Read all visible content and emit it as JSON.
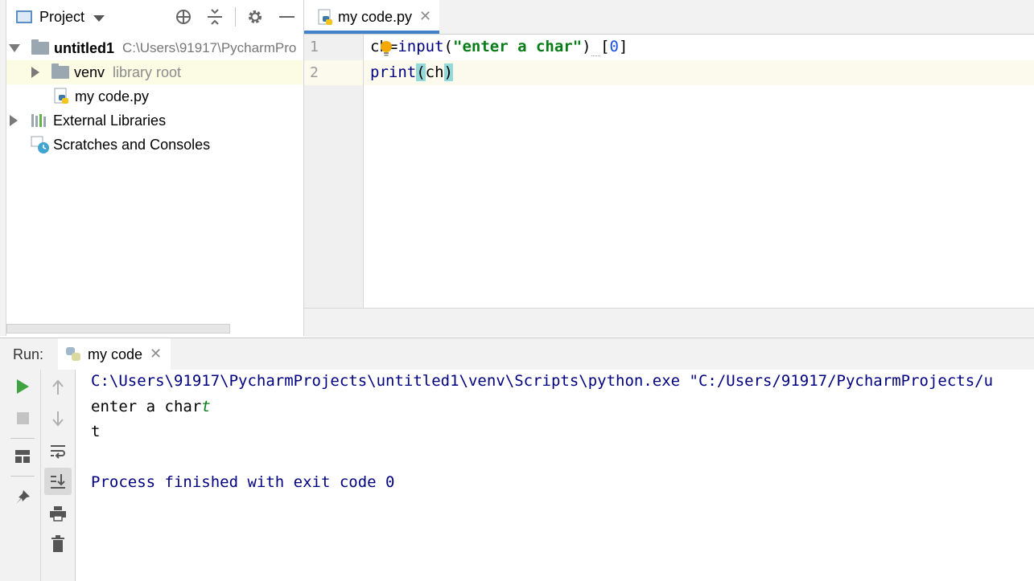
{
  "project": {
    "title": "Project",
    "root_name": "untitled1",
    "root_path": "C:\\Users\\91917\\PycharmPro",
    "venv_label": "venv",
    "venv_hint": "library root",
    "file_label": "my code.py",
    "external_label": "External Libraries",
    "scratches_label": "Scratches and Consoles"
  },
  "editor": {
    "tab_label": "my code.py",
    "line_numbers": [
      "1",
      "2"
    ],
    "line1": {
      "var": "ch",
      "eq": "=",
      "fn": "input",
      "open": "(",
      "str": "\"enter a char\"",
      "close": ")",
      "sp": " ",
      "lb": "[",
      "idx": "0",
      "rb": "]"
    },
    "line2": {
      "fn": "print",
      "open": "(",
      "arg": "ch",
      "close": ")"
    }
  },
  "run": {
    "label": "Run:",
    "tab_label": "my code",
    "console": {
      "command": "C:\\Users\\91917\\PycharmProjects\\untitled1\\venv\\Scripts\\python.exe \"C:/Users/91917/PycharmProjects/u",
      "prompt": "enter a char",
      "user_input": "t",
      "output": "t",
      "finished": "Process finished with exit code 0"
    }
  },
  "colors": {
    "keyword_blue": "#000080",
    "string_green": "#067d17",
    "number_blue": "#1750eb",
    "console_blue": "#000080",
    "run_green": "#3fa33f",
    "tab_accent": "#4083c9"
  }
}
